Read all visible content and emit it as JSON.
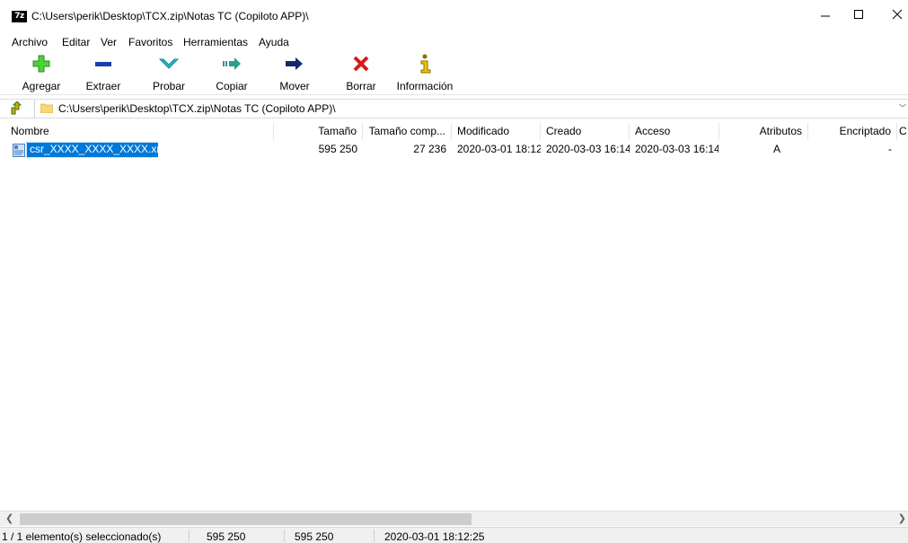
{
  "window": {
    "app_icon_text": "7z",
    "title": "C:\\Users\\perik\\Desktop\\TCX.zip\\Notas TC (Copiloto APP)\\"
  },
  "menu": [
    "Archivo",
    "Editar",
    "Ver",
    "Favoritos",
    "Herramientas",
    "Ayuda"
  ],
  "toolbar": {
    "add": "Agregar",
    "extract": "Extraer",
    "test": "Probar",
    "copy": "Copiar",
    "move": "Mover",
    "delete": "Borrar",
    "info": "Información"
  },
  "address": {
    "path": "C:\\Users\\perik\\Desktop\\TCX.zip\\Notas TC (Copiloto APP)\\"
  },
  "columns": {
    "name": "Nombre",
    "size": "Tamaño",
    "packed": "Tamaño comp...",
    "modified": "Modificado",
    "created": "Creado",
    "accessed": "Acceso",
    "attributes": "Atributos",
    "encrypted": "Encriptado",
    "extra": "C"
  },
  "files": [
    {
      "name": "csr_XXXX_XXXX_XXXX.xml",
      "size": "595 250",
      "packed": "27 236",
      "modified": "2020-03-01 18:12",
      "created": "2020-03-03 16:14",
      "accessed": "2020-03-03 16:14",
      "attributes": "A",
      "encrypted": "-"
    }
  ],
  "status": {
    "selection": "1 / 1 elemento(s) seleccionado(s)",
    "size": "595 250",
    "size2": "595 250",
    "date": "2020-03-01 18:12:25"
  },
  "colors": {
    "selection": "#0078d7",
    "add_icon": "#4cd137",
    "extract_icon": "#1a3fa8",
    "test_icon": "#2bb7c9",
    "copy_icon": "#2a9d8f",
    "move_icon": "#102a6b",
    "delete_icon": "#d7191c",
    "info_icon": "#8a6d00"
  }
}
